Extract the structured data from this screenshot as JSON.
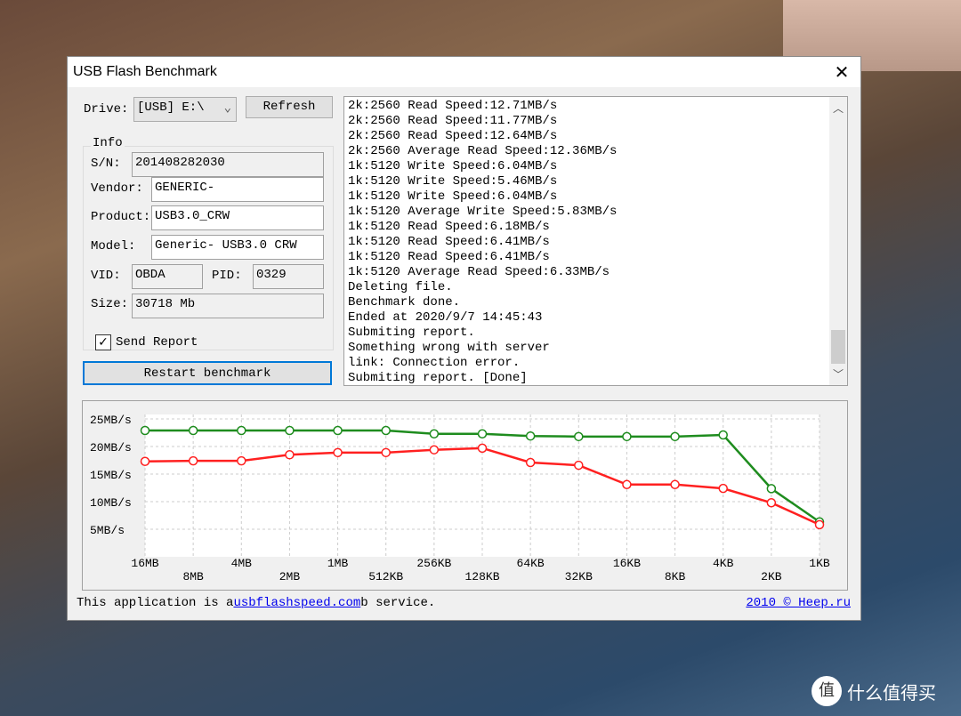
{
  "window": {
    "title": "USB Flash Benchmark"
  },
  "drive": {
    "label": "Drive:",
    "value": "[USB] E:\\",
    "refresh": "Refresh"
  },
  "info": {
    "legend": "Info",
    "sn_label": "S/N:",
    "sn": "201408282030",
    "vendor_label": "Vendor:",
    "vendor": "GENERIC-",
    "product_label": "Product:",
    "product": "USB3.0_CRW",
    "model_label": "Model:",
    "model": "Generic- USB3.0 CRW",
    "vid_label": "VID:",
    "vid": "OBDA",
    "pid_label": "PID:",
    "pid": "0329",
    "size_label": "Size:",
    "size": "30718 Mb"
  },
  "send_report": {
    "label": "Send Report",
    "checked": true
  },
  "restart_label": "Restart benchmark",
  "log": [
    "2k:2560 Read Speed:12.71MB/s",
    "2k:2560 Read Speed:11.77MB/s",
    "2k:2560 Read Speed:12.64MB/s",
    "2k:2560 Average Read Speed:12.36MB/s",
    "1k:5120 Write Speed:6.04MB/s",
    "1k:5120 Write Speed:5.46MB/s",
    "1k:5120 Write Speed:6.04MB/s",
    "1k:5120 Average Write Speed:5.83MB/s",
    "1k:5120 Read Speed:6.18MB/s",
    "1k:5120 Read Speed:6.41MB/s",
    "1k:5120 Read Speed:6.41MB/s",
    "1k:5120 Average Read Speed:6.33MB/s",
    "Deleting file.",
    "Benchmark done.",
    "Ended at 2020/9/7 14:45:43",
    "Submiting report.",
    "Something wrong with server",
    "link: Connection error.",
    "Submiting report. [Done]"
  ],
  "footer": {
    "prefix": "This application is a",
    "link": "usbflashspeed.com",
    "suffix": "b service.",
    "copyright": "2010 © Heep.ru"
  },
  "watermark": {
    "text": "什么值得买",
    "icon": "值"
  },
  "chart_data": {
    "type": "line",
    "categories": [
      "16MB",
      "8MB",
      "4MB",
      "2MB",
      "1MB",
      "512KB",
      "256KB",
      "128KB",
      "64KB",
      "32KB",
      "16KB",
      "8KB",
      "4KB",
      "2KB",
      "1KB"
    ],
    "yticks": [
      "25MB/s",
      "20MB/s",
      "15MB/s",
      "10MB/s",
      "5MB/s"
    ],
    "ylim": [
      0,
      25
    ],
    "grid": true,
    "series": [
      {
        "color": "#1e8c1e",
        "values": [
          22.9,
          22.9,
          22.9,
          22.9,
          22.9,
          22.9,
          22.3,
          22.3,
          21.9,
          21.8,
          21.8,
          21.8,
          22.1,
          12.36,
          6.33
        ]
      },
      {
        "color": "#ff2020",
        "values": [
          17.3,
          17.4,
          17.4,
          18.5,
          18.9,
          18.9,
          19.4,
          19.7,
          17.1,
          16.6,
          13.1,
          13.1,
          12.4,
          9.8,
          5.83
        ]
      }
    ]
  }
}
